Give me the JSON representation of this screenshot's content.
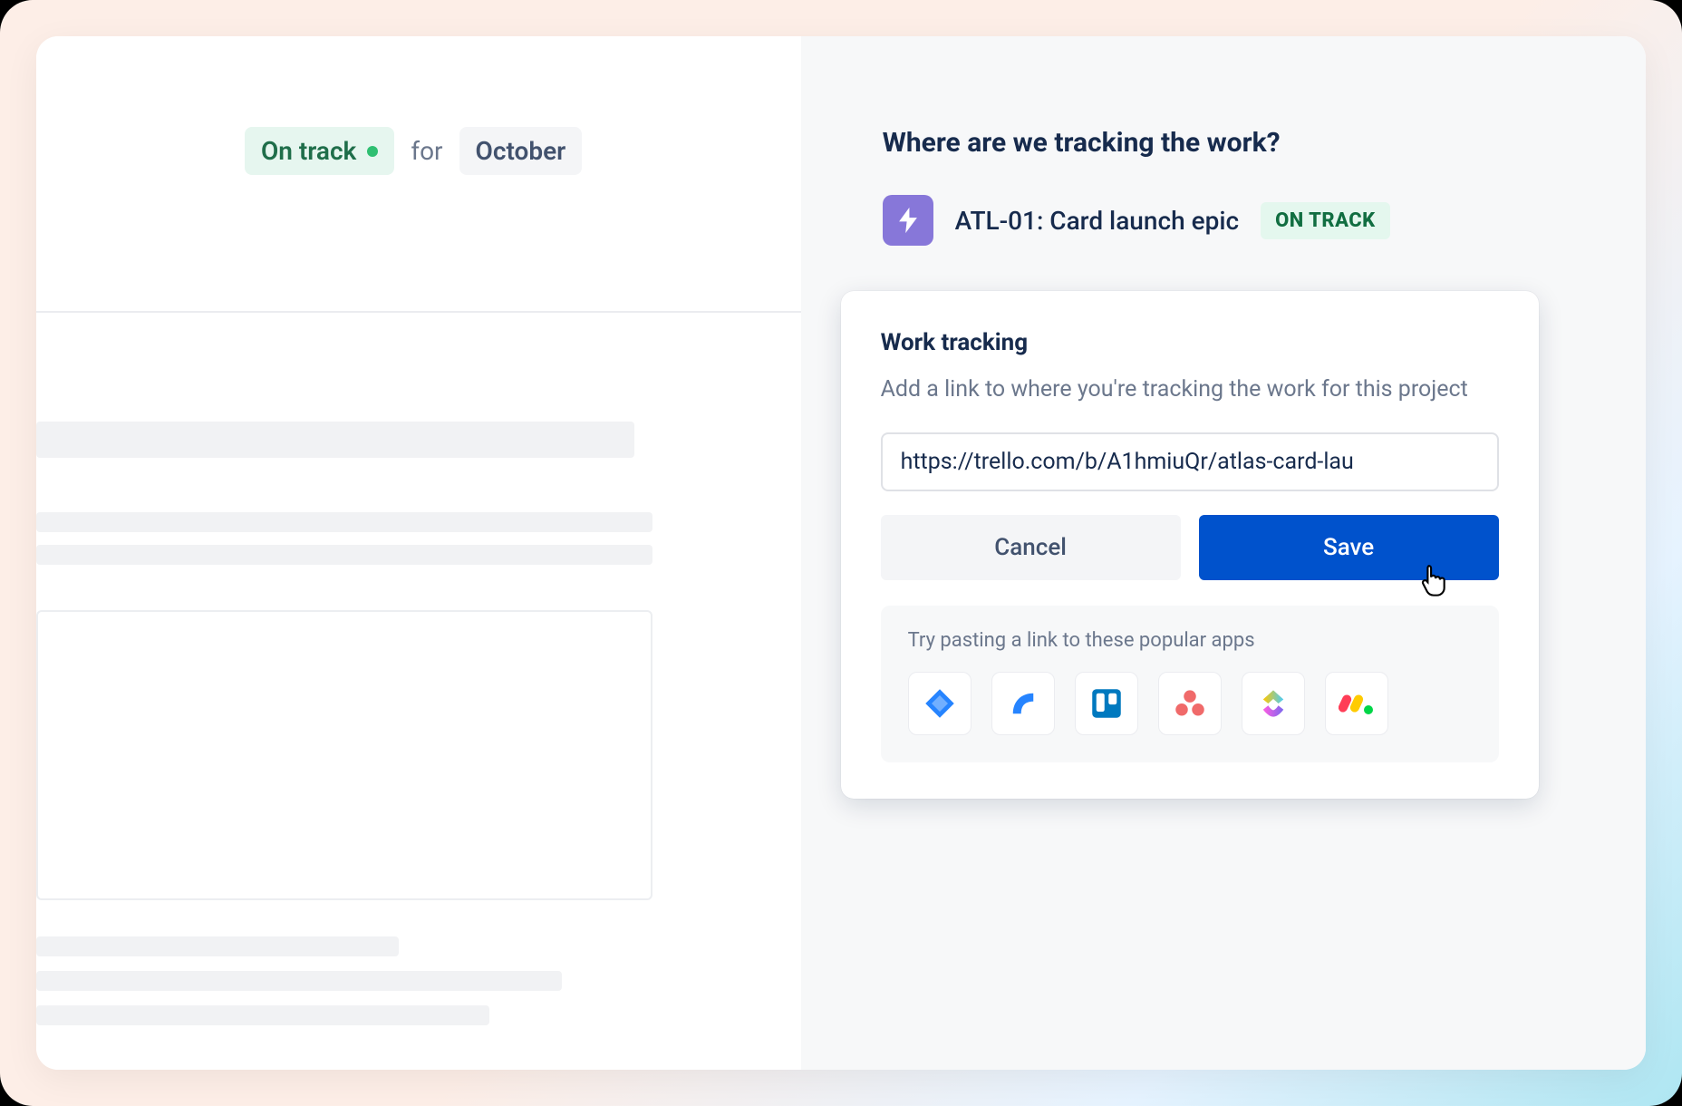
{
  "left": {
    "status_label": "On track",
    "for_label": "for",
    "month_label": "October"
  },
  "right": {
    "section_title": "Where are we tracking the work?",
    "epic_label": "ATL-01: Card launch epic",
    "epic_status": "ON TRACK"
  },
  "card": {
    "title": "Work tracking",
    "description": "Add a link to where you're tracking the work for this project",
    "url_value": "https://trello.com/b/A1hmiuQr/atlas-card-lau",
    "cancel_label": "Cancel",
    "save_label": "Save",
    "apps_hint": "Try pasting a link to these popular apps",
    "apps": [
      {
        "name": "jira"
      },
      {
        "name": "jira-product-discovery"
      },
      {
        "name": "trello"
      },
      {
        "name": "asana"
      },
      {
        "name": "clickup"
      },
      {
        "name": "monday"
      }
    ]
  }
}
